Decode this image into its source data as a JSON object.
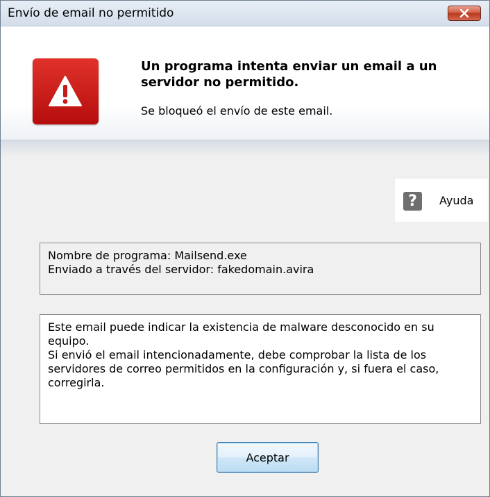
{
  "window": {
    "title": "Envío de email no permitido",
    "close_icon": "close-icon"
  },
  "header": {
    "icon": "warning-icon",
    "headline": "Un programa intenta enviar un email a un servidor no permitido.",
    "subline": "Se bloqueó el envío de este email."
  },
  "help": {
    "icon": "help-icon",
    "icon_glyph": "?",
    "label": "Ayuda"
  },
  "details": {
    "program_line": "Nombre de programa: Mailsend.exe",
    "server_line": "Enviado a través del servidor: fakedomain.avira"
  },
  "message": {
    "paragraph_1": "Este email puede indicar la existencia de malware desconocido en su equipo.",
    "paragraph_2": "Si envió el email intencionadamente, debe comprobar la lista de los servidores de correo permitidos en la configuración y, si fuera el caso, corregirla."
  },
  "actions": {
    "accept_label": "Aceptar"
  },
  "colors": {
    "warning_red": "#c81a16",
    "close_red": "#c84a30",
    "button_border": "#3c7fb1"
  }
}
